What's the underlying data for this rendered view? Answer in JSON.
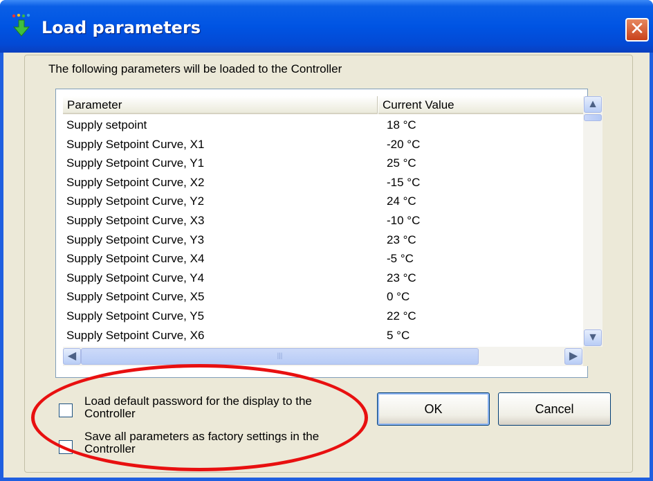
{
  "window": {
    "title": "Load parameters",
    "close_glyph": "✕"
  },
  "intro": "The following parameters will be loaded to the Controller",
  "list": {
    "columns": [
      "Parameter",
      "Current Value"
    ],
    "rows": [
      [
        "Supply setpoint",
        "18 °C"
      ],
      [
        "Supply Setpoint Curve, X1",
        "-20 °C"
      ],
      [
        "Supply Setpoint Curve, Y1",
        "25 °C"
      ],
      [
        "Supply Setpoint Curve, X2",
        "-15 °C"
      ],
      [
        "Supply Setpoint Curve, Y2",
        "24 °C"
      ],
      [
        "Supply Setpoint Curve, X3",
        "-10 °C"
      ],
      [
        "Supply Setpoint Curve, Y3",
        "23 °C"
      ],
      [
        "Supply Setpoint Curve, X4",
        "-5 °C"
      ],
      [
        "Supply Setpoint Curve, Y4",
        "23 °C"
      ],
      [
        "Supply Setpoint Curve, X5",
        "0 °C"
      ],
      [
        "Supply Setpoint Curve, Y5",
        "22 °C"
      ],
      [
        "Supply Setpoint Curve, X6",
        "5 °C"
      ]
    ],
    "scroll_up_glyph": "▲",
    "scroll_down_glyph": "▼",
    "scroll_left_glyph": "◀",
    "scroll_right_glyph": "▶",
    "hthumb_grip": "|||"
  },
  "options": {
    "default_password": "Load default password for the display to the Controller",
    "factory_settings": "Save all parameters as factory settings in the Controller"
  },
  "buttons": {
    "ok": "OK",
    "cancel": "Cancel"
  },
  "icons": {
    "title": "load-arrow-icon",
    "close": "close-icon"
  },
  "colors": {
    "titlebar": "#0054e3",
    "dialog_bg": "#ece9d8",
    "highlight_ring": "#e81010"
  }
}
